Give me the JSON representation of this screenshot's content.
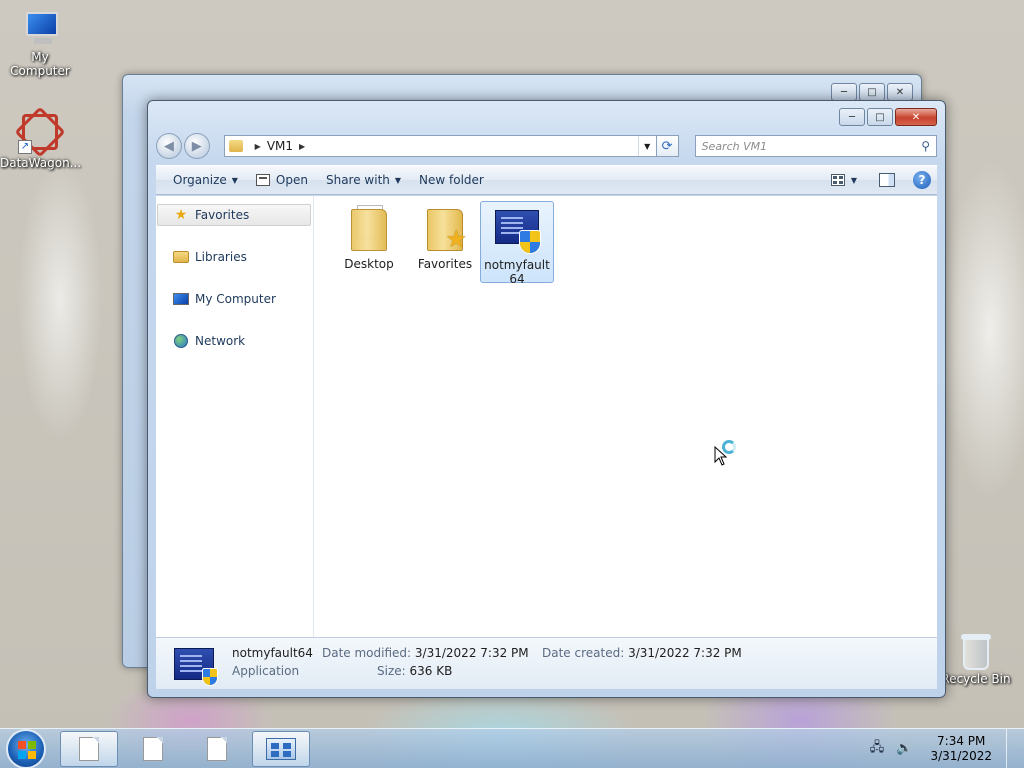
{
  "desktop": {
    "icons": [
      {
        "label": "My Computer"
      },
      {
        "label": "DataWagon..."
      },
      {
        "label": "Recycle Bin"
      }
    ]
  },
  "window": {
    "address": {
      "crumbs": [
        "VM1"
      ],
      "search_placeholder": "Search VM1"
    },
    "caption_buttons": {
      "minimize": "─",
      "maximize": "□",
      "close": "✕"
    },
    "toolbar": {
      "organize": "Organize",
      "open": "Open",
      "share_with": "Share with",
      "new_folder": "New folder",
      "help": "?"
    },
    "nav_pane": {
      "items": [
        {
          "label": "Favorites",
          "icon": "star-icon",
          "selected": true
        },
        {
          "label": "Libraries",
          "icon": "libraries-icon"
        },
        {
          "label": "My Computer",
          "icon": "computer-icon"
        },
        {
          "label": "Network",
          "icon": "network-icon"
        }
      ]
    },
    "files": [
      {
        "name": "Desktop",
        "type": "folder"
      },
      {
        "name": "Favorites",
        "type": "favorites-folder"
      },
      {
        "name_line1": "notmyfault",
        "name_line2": "64",
        "type": "application",
        "selected": true
      }
    ],
    "details": {
      "name": "notmyfault64",
      "type": "Application",
      "date_modified_label": "Date modified:",
      "date_modified": "3/31/2022 7:32 PM",
      "date_created_label": "Date created:",
      "date_created": "3/31/2022 7:32 PM",
      "size_label": "Size:",
      "size": "636 KB"
    }
  },
  "taskbar": {
    "buttons": [
      {
        "name": "notepad-1",
        "icon": "document-icon",
        "active": true
      },
      {
        "name": "notepad-2",
        "icon": "document-icon"
      },
      {
        "name": "notepad-3",
        "icon": "document-icon"
      },
      {
        "name": "control-panel",
        "icon": "control-panel-icon",
        "active": true
      }
    ],
    "clock": {
      "time": "7:34 PM",
      "date": "3/31/2022"
    }
  }
}
